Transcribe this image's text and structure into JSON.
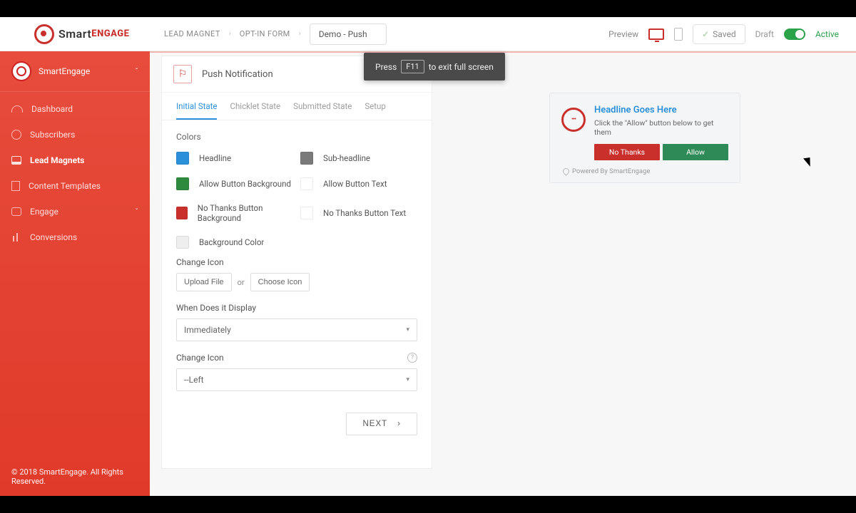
{
  "logo": {
    "part1": "Smart",
    "part2": "ENGAGE"
  },
  "breadcrumb": {
    "a": "LEAD MAGNET",
    "b": "OPT-IN FORM",
    "c": "Demo - Push"
  },
  "fullscreen_toast": {
    "pre": "Press",
    "key": "F11",
    "post": "to exit full screen"
  },
  "topbar": {
    "preview": "Preview",
    "saved": "Saved",
    "draft": "Draft",
    "active": "Active"
  },
  "workspace": {
    "name": "SmartEngage"
  },
  "nav": {
    "dashboard": "Dashboard",
    "subscribers": "Subscribers",
    "lead_magnets": "Lead Magnets",
    "content_templates": "Content Templates",
    "engage": "Engage",
    "conversions": "Conversions"
  },
  "footer": "© 2018 SmartEngage. All Rights Reserved.",
  "panel": {
    "title": "Push Notification",
    "tabs": {
      "initial": "Initial State",
      "chicklet": "Chicklet State",
      "submitted": "Submitted State",
      "setup": "Setup"
    },
    "colors_title": "Colors",
    "colors": {
      "headline": {
        "label": "Headline",
        "hex": "#2b90d9"
      },
      "subheadline": {
        "label": "Sub-headline",
        "hex": "#7a7a7a"
      },
      "allow_bg": {
        "label": "Allow Button Background",
        "hex": "#2e8b3d"
      },
      "allow_text": {
        "label": "Allow Button Text",
        "hex": "#ffffff"
      },
      "no_bg": {
        "label": "No Thanks Button Background",
        "hex": "#c9302c"
      },
      "no_text": {
        "label": "No Thanks Button Text",
        "hex": "#ffffff"
      },
      "background": {
        "label": "Background Color",
        "hex": "#eeeeee"
      }
    },
    "change_icon_label": "Change Icon",
    "upload_btn": "Upload File",
    "or": "or",
    "choose_btn": "Choose Icon",
    "when_label": "When Does it Display",
    "when_value": "Immediately",
    "pos_label": "Change Icon",
    "pos_value": "--Left",
    "next": "NEXT"
  },
  "preview": {
    "headline": "Headline Goes Here",
    "sub": "Click the \"Allow\" button below to get them",
    "no": "No Thanks",
    "allow": "Allow",
    "powered": "Powered By SmartEngage"
  }
}
